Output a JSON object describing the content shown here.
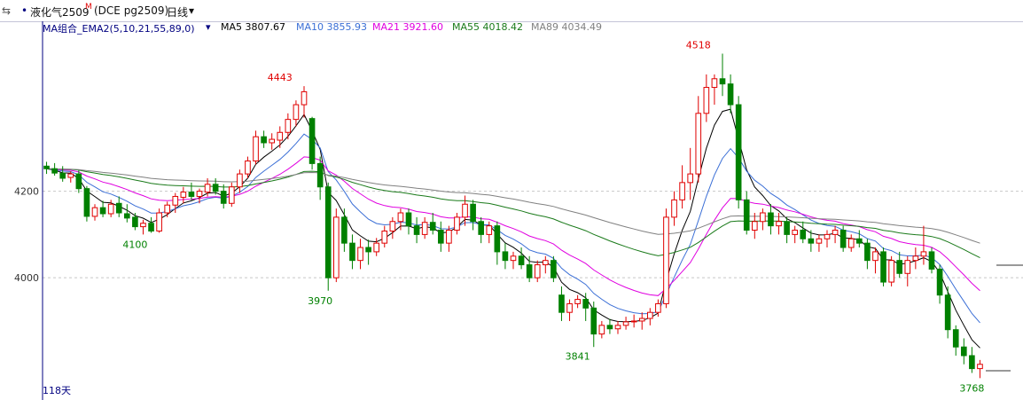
{
  "header": {
    "icon_left": "⇆",
    "dot": "•",
    "symbol": "液化气2509",
    "symbol_mark": "M",
    "exchange": "(DCE pg2509)",
    "period": "日线",
    "period_caret": "▾"
  },
  "legend": {
    "indicator": "MA组合_EMA2(5,10,21,55,89,0)",
    "caret": "▾",
    "ma5": "MA5 3807.67",
    "ma10": "MA10 3855.93",
    "ma21": "MA21 3921.60",
    "ma55": "MA55 4018.42",
    "ma89": "MA89 4034.49"
  },
  "footer": {
    "days": "118天"
  },
  "colors": {
    "up": "#e00000",
    "down": "#008000",
    "ma5": "#000000",
    "ma10": "#3b6fd6",
    "ma21": "#e000e0",
    "ma55": "#1a7a1a",
    "ma89": "#808080",
    "grid": "#c8c8c8",
    "axis": "#000080"
  },
  "chart_data": {
    "type": "candlestick",
    "title": "液化气2509 (DCE pg2509) 日线",
    "ylim": [
      3740,
      4560
    ],
    "y_ticks": [
      4000,
      4200
    ],
    "y_tick_labels": [
      "4000",
      "4200"
    ],
    "grid": true,
    "bar_count": 118,
    "annotations": [
      {
        "label": "4443",
        "index": 29,
        "value": 4443,
        "kind": "high"
      },
      {
        "label": "4100",
        "index": 11,
        "value": 4100,
        "kind": "low"
      },
      {
        "label": "3970",
        "index": 34,
        "value": 3970,
        "kind": "low"
      },
      {
        "label": "3841",
        "index": 66,
        "value": 3841,
        "kind": "low"
      },
      {
        "label": "4518",
        "index": 81,
        "value": 4518,
        "kind": "high"
      },
      {
        "label": "3768",
        "index": 115,
        "value": 3768,
        "kind": "low"
      }
    ],
    "ohlc": [
      [
        4258,
        4268,
        4240,
        4252
      ],
      [
        4252,
        4265,
        4236,
        4242
      ],
      [
        4242,
        4258,
        4222,
        4230
      ],
      [
        4232,
        4246,
        4220,
        4240
      ],
      [
        4240,
        4248,
        4196,
        4206
      ],
      [
        4206,
        4212,
        4130,
        4142
      ],
      [
        4142,
        4170,
        4132,
        4162
      ],
      [
        4162,
        4178,
        4140,
        4148
      ],
      [
        4148,
        4180,
        4140,
        4170
      ],
      [
        4172,
        4188,
        4140,
        4150
      ],
      [
        4148,
        4170,
        4128,
        4138
      ],
      [
        4140,
        4150,
        4110,
        4118
      ],
      [
        4118,
        4134,
        4100,
        4126
      ],
      [
        4126,
        4140,
        4104,
        4108
      ],
      [
        4108,
        4160,
        4104,
        4150
      ],
      [
        4150,
        4176,
        4140,
        4168
      ],
      [
        4168,
        4196,
        4150,
        4188
      ],
      [
        4186,
        4210,
        4172,
        4198
      ],
      [
        4198,
        4220,
        4180,
        4188
      ],
      [
        4188,
        4206,
        4172,
        4200
      ],
      [
        4198,
        4230,
        4188,
        4216
      ],
      [
        4216,
        4230,
        4192,
        4200
      ],
      [
        4200,
        4216,
        4160,
        4172
      ],
      [
        4172,
        4220,
        4164,
        4210
      ],
      [
        4210,
        4250,
        4196,
        4240
      ],
      [
        4240,
        4280,
        4230,
        4270
      ],
      [
        4270,
        4340,
        4262,
        4326
      ],
      [
        4326,
        4340,
        4300,
        4312
      ],
      [
        4312,
        4334,
        4296,
        4320
      ],
      [
        4318,
        4350,
        4300,
        4336
      ],
      [
        4336,
        4380,
        4320,
        4366
      ],
      [
        4366,
        4410,
        4350,
        4400
      ],
      [
        4400,
        4443,
        4370,
        4430
      ],
      [
        4368,
        4372,
        4250,
        4264
      ],
      [
        4264,
        4280,
        4180,
        4210
      ],
      [
        4210,
        4220,
        3970,
        4000
      ],
      [
        4000,
        4160,
        3990,
        4140
      ],
      [
        4140,
        4160,
        4060,
        4080
      ],
      [
        4080,
        4100,
        4020,
        4040
      ],
      [
        4040,
        4090,
        4020,
        4070
      ],
      [
        4070,
        4088,
        4030,
        4060
      ],
      [
        4060,
        4092,
        4050,
        4080
      ],
      [
        4080,
        4120,
        4070,
        4108
      ],
      [
        4108,
        4140,
        4090,
        4130
      ],
      [
        4130,
        4160,
        4110,
        4150
      ],
      [
        4150,
        4160,
        4100,
        4120
      ],
      [
        4120,
        4140,
        4080,
        4100
      ],
      [
        4100,
        4140,
        4090,
        4128
      ],
      [
        4128,
        4150,
        4100,
        4110
      ],
      [
        4110,
        4130,
        4060,
        4080
      ],
      [
        4080,
        4120,
        4060,
        4110
      ],
      [
        4110,
        4150,
        4100,
        4140
      ],
      [
        4140,
        4190,
        4120,
        4170
      ],
      [
        4170,
        4180,
        4110,
        4130
      ],
      [
        4130,
        4140,
        4080,
        4100
      ],
      [
        4100,
        4130,
        4080,
        4120
      ],
      [
        4120,
        4130,
        4030,
        4060
      ],
      [
        4060,
        4080,
        4020,
        4040
      ],
      [
        4040,
        4060,
        4020,
        4050
      ],
      [
        4050,
        4070,
        4020,
        4030
      ],
      [
        4030,
        4050,
        3990,
        4000
      ],
      [
        4000,
        4040,
        3990,
        4030
      ],
      [
        4030,
        4050,
        4010,
        4040
      ],
      [
        4040,
        4050,
        3990,
        4000
      ],
      [
        3960,
        3980,
        3900,
        3920
      ],
      [
        3920,
        3950,
        3900,
        3940
      ],
      [
        3940,
        3960,
        3930,
        3950
      ],
      [
        3950,
        3965,
        3900,
        3930
      ],
      [
        3930,
        3945,
        3840,
        3870
      ],
      [
        3870,
        3900,
        3860,
        3890
      ],
      [
        3890,
        3905,
        3870,
        3882
      ],
      [
        3882,
        3900,
        3870,
        3890
      ],
      [
        3890,
        3910,
        3880,
        3898
      ],
      [
        3898,
        3915,
        3885,
        3900
      ],
      [
        3900,
        3920,
        3880,
        3906
      ],
      [
        3906,
        3930,
        3890,
        3920
      ],
      [
        3920,
        3950,
        3910,
        3940
      ],
      [
        3940,
        4160,
        3930,
        4140
      ],
      [
        4140,
        4200,
        4120,
        4180
      ],
      [
        4180,
        4260,
        4160,
        4220
      ],
      [
        4220,
        4300,
        4180,
        4240
      ],
      [
        4240,
        4420,
        4220,
        4380
      ],
      [
        4380,
        4470,
        4360,
        4440
      ],
      [
        4440,
        4470,
        4400,
        4460
      ],
      [
        4460,
        4518,
        4420,
        4448
      ],
      [
        4448,
        4470,
        4380,
        4400
      ],
      [
        4400,
        4420,
        4160,
        4180
      ],
      [
        4180,
        4200,
        4100,
        4110
      ],
      [
        4110,
        4150,
        4090,
        4130
      ],
      [
        4130,
        4160,
        4110,
        4150
      ],
      [
        4150,
        4170,
        4100,
        4120
      ],
      [
        4120,
        4150,
        4100,
        4130
      ],
      [
        4130,
        4140,
        4080,
        4100
      ],
      [
        4100,
        4120,
        4080,
        4110
      ],
      [
        4110,
        4130,
        4080,
        4090
      ],
      [
        4090,
        4110,
        4060,
        4080
      ],
      [
        4080,
        4100,
        4060,
        4090
      ],
      [
        4090,
        4110,
        4070,
        4100
      ],
      [
        4100,
        4120,
        4080,
        4110
      ],
      [
        4110,
        4120,
        4060,
        4070
      ],
      [
        4070,
        4100,
        4060,
        4090
      ],
      [
        4090,
        4110,
        4070,
        4080
      ],
      [
        4080,
        4090,
        4020,
        4040
      ],
      [
        4040,
        4070,
        4010,
        4060
      ],
      [
        4060,
        4070,
        3980,
        3990
      ],
      [
        3990,
        4050,
        3980,
        4040
      ],
      [
        4040,
        4060,
        4000,
        4010
      ],
      [
        4010,
        4050,
        3980,
        4040
      ],
      [
        4040,
        4070,
        4020,
        4050
      ],
      [
        4050,
        4120,
        4030,
        4060
      ],
      [
        4060,
        4070,
        4010,
        4020
      ],
      [
        4020,
        4030,
        3940,
        3960
      ],
      [
        3960,
        3980,
        3860,
        3880
      ],
      [
        3880,
        3890,
        3820,
        3840
      ],
      [
        3840,
        3860,
        3800,
        3820
      ],
      [
        3820,
        3840,
        3780,
        3790
      ],
      [
        3790,
        3810,
        3768,
        3800
      ]
    ],
    "series": [
      {
        "name": "MA5",
        "values": []
      },
      {
        "name": "MA10",
        "values": []
      },
      {
        "name": "MA21",
        "values": []
      },
      {
        "name": "MA55",
        "values": []
      },
      {
        "name": "MA89",
        "values": []
      }
    ]
  }
}
